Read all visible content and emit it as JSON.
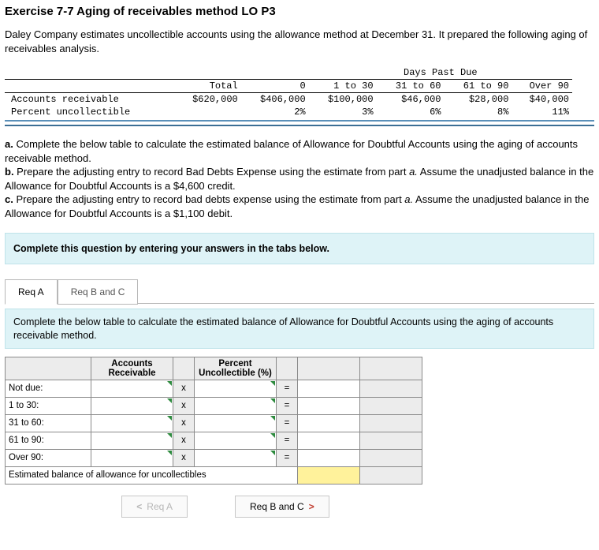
{
  "title": "Exercise 7-7 Aging of receivables method LO P3",
  "intro": "Daley Company estimates uncollectible accounts using the allowance method at December 31. It prepared the following aging of receivables analysis.",
  "mono": {
    "super_header": "Days Past Due",
    "cols": {
      "total": "Total",
      "c0": "0",
      "c1": "1 to 30",
      "c2": "31 to 60",
      "c3": "61 to 90",
      "c4": "Over 90"
    },
    "row1_label": "Accounts receivable",
    "row1": {
      "total": "$620,000",
      "c0": "$406,000",
      "c1": "$100,000",
      "c2": "$46,000",
      "c3": "$28,000",
      "c4": "$40,000"
    },
    "row2_label": "Percent uncollectible",
    "row2": {
      "c0": "2%",
      "c1": "3%",
      "c2": "6%",
      "c3": "8%",
      "c4": "11%"
    }
  },
  "parts": {
    "a_b": "a.",
    "a": " Complete the below table to calculate the estimated balance of Allowance for Doubtful Accounts using the aging of accounts receivable method.",
    "b_b": "b.",
    "b_1": " Prepare the adjusting entry to record Bad Debts Expense using the estimate from part ",
    "b_i": "a.",
    "b_2": " Assume the unadjusted balance in the Allowance for Doubtful Accounts is a $4,600 credit.",
    "c_b": "c.",
    "c_1": " Prepare the adjusting entry to record bad debts expense using the estimate from part ",
    "c_i": "a.",
    "c_2": " Assume the unadjusted balance in the Allowance for Doubtful Accounts is a $1,100 debit."
  },
  "panel": "Complete this question by entering your answers in the tabs below.",
  "tabs": {
    "a": "Req A",
    "bc": "Req B and C"
  },
  "instruction": "Complete the below table to calculate the estimated balance of Allowance for Doubtful Accounts using the aging of accounts receivable method.",
  "tbl": {
    "h1": "Accounts Receivable",
    "h2": "Percent Uncollectible (%)",
    "rows": [
      "Not due:",
      "1 to 30:",
      "31 to 60:",
      "61 to 90:",
      "Over 90:"
    ],
    "x": "x",
    "eq": "=",
    "footer": "Estimated balance of allowance for uncollectibles"
  },
  "nav": {
    "prev": "Req A",
    "next": "Req B and C"
  }
}
